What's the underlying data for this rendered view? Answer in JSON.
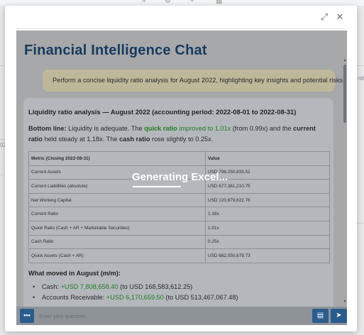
{
  "modal": {
    "expand_icon": "⤢",
    "close_icon": "✕"
  },
  "chat": {
    "title": "Financial Intelligence Chat",
    "user_message": "Perform a concise liquidity ratio analysis for August 2022, highlighting key insights and potential risks.",
    "answer": {
      "heading": "Liquidity ratio analysis — August 2022 (accounting period: 2022-08-01 to 2022-08-31)",
      "bottom_line_label": "Bottom line:",
      "bottom_line_text1": " Liquidity is adequate. The ",
      "quick_ratio_label": "quick ratio",
      "quick_ratio_change": " improved to 1.01x",
      "bottom_line_text2": " (from 0.99x) and the ",
      "current_ratio_label": "current ratio",
      "bottom_line_text3": " held steady at 1.18x. The ",
      "cash_ratio_label": "cash ratio",
      "bottom_line_text4": " rose slightly to 0.25x.",
      "table": {
        "headers": [
          "Metric (Closing 2022-08-31)",
          "Value"
        ],
        "rows": [
          [
            "Current Assets",
            "USD 798,250,833.51"
          ],
          [
            "Current Liabilities (absolute)",
            "USD 677,381,210.75"
          ],
          [
            "Net Working Capital",
            "USD 120,979,622.76"
          ],
          [
            "Current Ratio",
            "1.18x"
          ],
          [
            "Quick Ratio (Cash + AR + Marketable Securities)",
            "1.01x"
          ],
          [
            "Cash Ratio",
            "0.25x"
          ],
          [
            "Quick Assets (Cash + AR)",
            "USD 682,050,679.73"
          ]
        ]
      },
      "moved_heading": "What moved in August (m/m):",
      "moved_items": [
        {
          "label": "Cash: ",
          "change": "+USD 7,808,658.40",
          "rest": " (to USD 168,583,612.25)"
        },
        {
          "label": "Accounts Receivable: ",
          "change": "+USD 6,170,659.50",
          "rest": " (to USD 513,467,067.48)"
        }
      ]
    },
    "overlay": "Generating Excel...",
    "input_placeholder": "Enter your question...",
    "menu_label": "•••"
  },
  "colors": {
    "title": "#173a5e",
    "accent": "#2b5c8e",
    "positive": "#247a24"
  }
}
